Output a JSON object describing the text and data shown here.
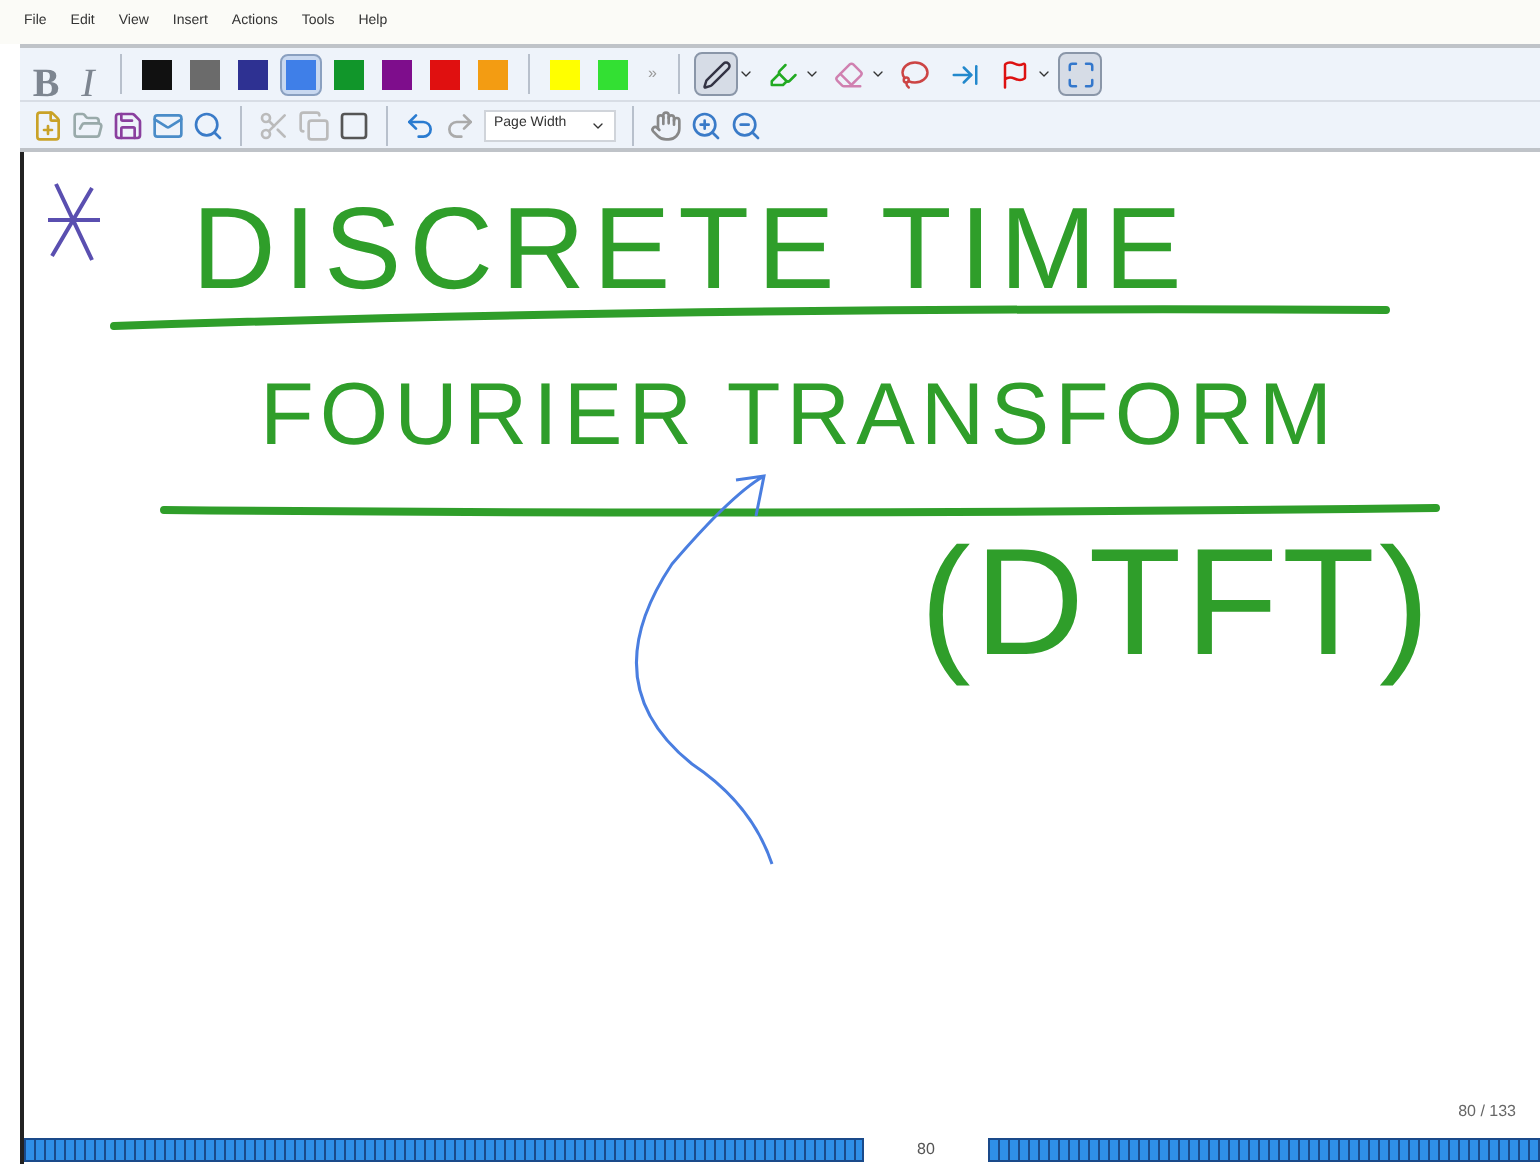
{
  "menu": [
    "File",
    "Edit",
    "View",
    "Insert",
    "Actions",
    "Tools",
    "Help"
  ],
  "format_buttons": [
    {
      "label": "B",
      "kind": "bold"
    },
    {
      "label": "I",
      "kind": "italic"
    }
  ],
  "pen_colors": [
    {
      "color": "#111111",
      "selected": false
    },
    {
      "color": "#6b6b6b",
      "selected": false
    },
    {
      "color": "#2e3192",
      "selected": false
    },
    {
      "color": "#3f7fe8",
      "selected": true
    },
    {
      "color": "#11962a",
      "selected": false
    },
    {
      "color": "#7e0d8c",
      "selected": false
    },
    {
      "color": "#e01010",
      "selected": false
    },
    {
      "color": "#f39c12",
      "selected": false
    },
    {
      "color": "#ffff00",
      "selected": false
    },
    {
      "color": "#33e033",
      "selected": false
    }
  ],
  "more_label": "»",
  "tools": [
    {
      "kind": "pen",
      "selected": true
    },
    {
      "kind": "highlighter",
      "selected": false
    },
    {
      "kind": "eraser",
      "selected": false
    },
    {
      "kind": "lasso",
      "selected": false
    },
    {
      "kind": "insert-space",
      "selected": false
    },
    {
      "kind": "flag",
      "selected": false
    },
    {
      "kind": "full-screen",
      "selected": true
    }
  ],
  "zoom_select": {
    "value": "Page Width"
  },
  "ink": [
    {
      "text": "DISCRETE TIME",
      "kind": "title"
    },
    {
      "text": "FOURIER TRANSFORM",
      "kind": "subtitle"
    },
    {
      "text": "(DTFT)",
      "kind": "abbrev"
    }
  ],
  "page_counter": "80 / 133",
  "page_number": "80"
}
